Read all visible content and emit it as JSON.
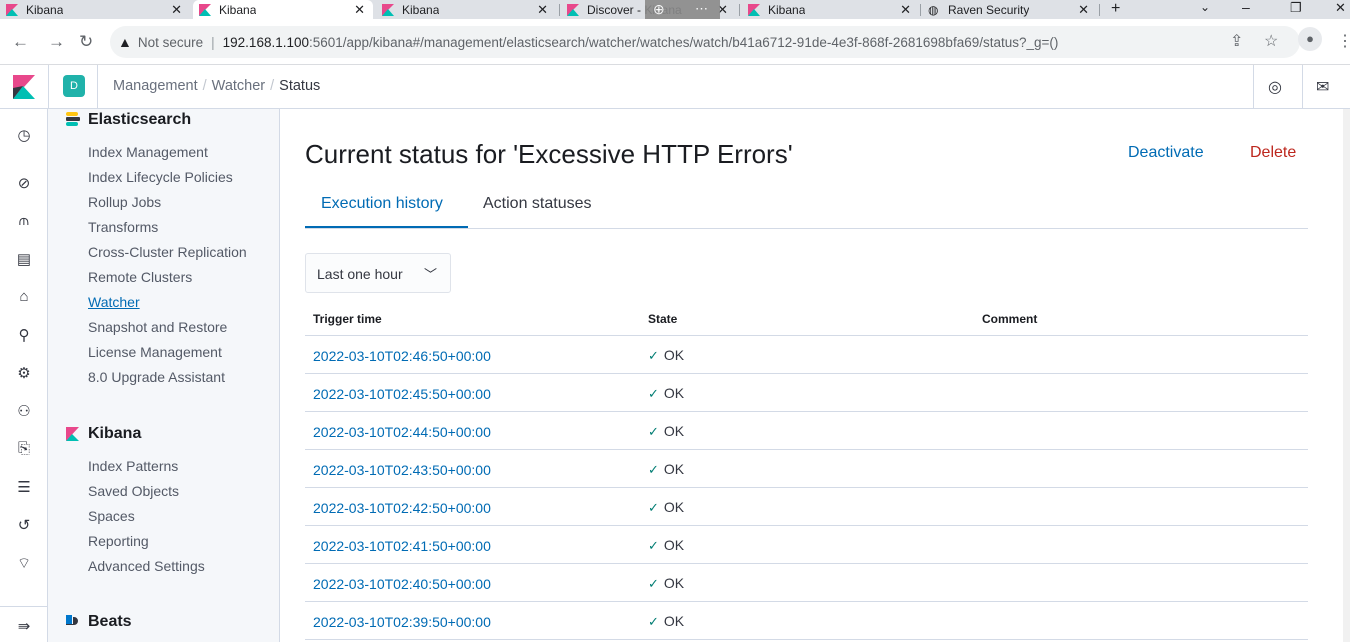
{
  "browser": {
    "tabs": [
      {
        "title": "Kibana"
      },
      {
        "title": "Kibana"
      },
      {
        "title": "Kibana"
      },
      {
        "title": "Discover - Kibana"
      },
      {
        "title": "Kibana"
      },
      {
        "title": "Raven Security"
      }
    ],
    "url": {
      "security_label": "Not secure",
      "host": "192.168.1.100",
      "path": ":5601/app/kibana#/management/elasticsearch/watcher/watches/watch/b41a6712-91de-4e3f-868f-2681698bfa69/status?_g=()"
    }
  },
  "header": {
    "space_initial": "D",
    "breadcrumbs": [
      "Management",
      "Watcher",
      "Status"
    ]
  },
  "sidebar": {
    "elasticsearch": {
      "title": "Elasticsearch",
      "items": [
        "Index Management",
        "Index Lifecycle Policies",
        "Rollup Jobs",
        "Transforms",
        "Cross-Cluster Replication",
        "Remote Clusters",
        "Watcher",
        "Snapshot and Restore",
        "License Management",
        "8.0 Upgrade Assistant"
      ]
    },
    "kibana": {
      "title": "Kibana",
      "items": [
        "Index Patterns",
        "Saved Objects",
        "Spaces",
        "Reporting",
        "Advanced Settings"
      ]
    },
    "beats": {
      "title": "Beats"
    }
  },
  "main": {
    "title": "Current status for 'Excessive HTTP Errors'",
    "actions": {
      "deactivate": "Deactivate",
      "delete": "Delete"
    },
    "tabs": [
      "Execution history",
      "Action statuses"
    ],
    "time_select": "Last one hour",
    "table": {
      "headers": [
        "Trigger time",
        "State",
        "Comment"
      ],
      "rows": [
        {
          "time": "2022-03-10T02:46:50+00:00",
          "state": "OK",
          "comment": ""
        },
        {
          "time": "2022-03-10T02:45:50+00:00",
          "state": "OK",
          "comment": ""
        },
        {
          "time": "2022-03-10T02:44:50+00:00",
          "state": "OK",
          "comment": ""
        },
        {
          "time": "2022-03-10T02:43:50+00:00",
          "state": "OK",
          "comment": ""
        },
        {
          "time": "2022-03-10T02:42:50+00:00",
          "state": "OK",
          "comment": ""
        },
        {
          "time": "2022-03-10T02:41:50+00:00",
          "state": "OK",
          "comment": ""
        },
        {
          "time": "2022-03-10T02:40:50+00:00",
          "state": "OK",
          "comment": ""
        },
        {
          "time": "2022-03-10T02:39:50+00:00",
          "state": "OK",
          "comment": ""
        }
      ]
    }
  }
}
